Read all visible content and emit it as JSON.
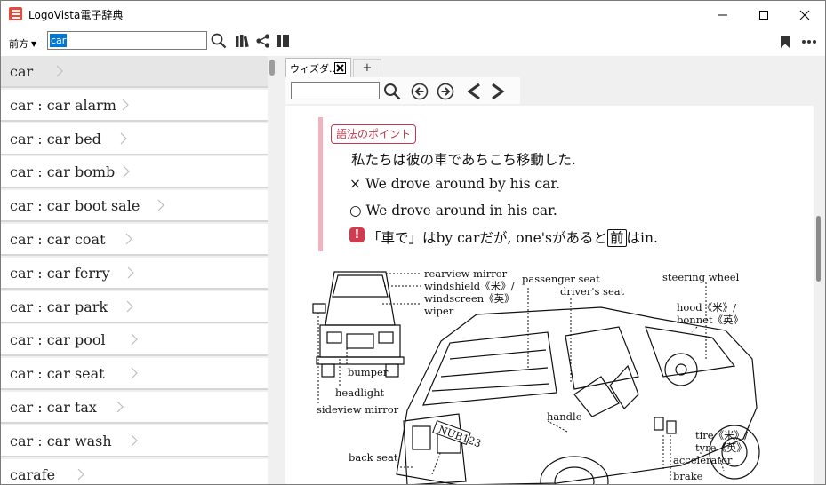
{
  "window": {
    "title": "LogoVista電子辞典",
    "controls": [
      "minimize",
      "maximize",
      "close"
    ]
  },
  "toolbar": {
    "back_label": "前方",
    "search_value": "car",
    "icons": [
      "search-icon",
      "books-icon",
      "share-icon",
      "panel-toggle-icon",
      "bookmark-icon",
      "more-icon"
    ]
  },
  "results": [
    {
      "label": "car"
    },
    {
      "label": "car : car alarm"
    },
    {
      "label": "car : car bed"
    },
    {
      "label": "car : car bomb"
    },
    {
      "label": "car : car boot sale"
    },
    {
      "label": "car : car coat"
    },
    {
      "label": "car : car ferry"
    },
    {
      "label": "car : car park"
    },
    {
      "label": "car : car pool"
    },
    {
      "label": "car : car seat"
    },
    {
      "label": "car : car tax"
    },
    {
      "label": "car : car wash"
    },
    {
      "label": "carafe"
    }
  ],
  "tabs": [
    {
      "label": "ウィズダ..."
    }
  ],
  "tab_add_label": "+",
  "entry": {
    "usage_badge": "語法のポイント",
    "example_ja": "私たちは彼の車であちこち移動した.",
    "wrong_mark": "×",
    "wrong_example": "We drove around by his car.",
    "right_mark": "○",
    "right_example": "We drove around in his car.",
    "note_icon": "!",
    "note_before": "「車で」はby carだが, one'sがあると",
    "note_boxed": "前",
    "note_after": "はin.",
    "labels": {
      "rearview_mirror": "rearview mirror",
      "windshield": "windshield《米》/",
      "windscreen": "windscreen《英》",
      "wiper": "wiper",
      "bumper": "bumper",
      "headlight": "headlight",
      "sideview_mirror": "sideview mirror",
      "back_seat": "back seat",
      "passenger_seat": "passenger seat",
      "drivers_seat": "driver's seat",
      "steering_wheel": "steering wheel",
      "hood": "hood《米》/",
      "bonnet": "bonnet《英》",
      "handle": "handle",
      "tire": "tire《米》/",
      "tyre": "tyre《英》",
      "accelerator": "accelerator",
      "brake": "brake",
      "plate": "NUB123"
    }
  }
}
